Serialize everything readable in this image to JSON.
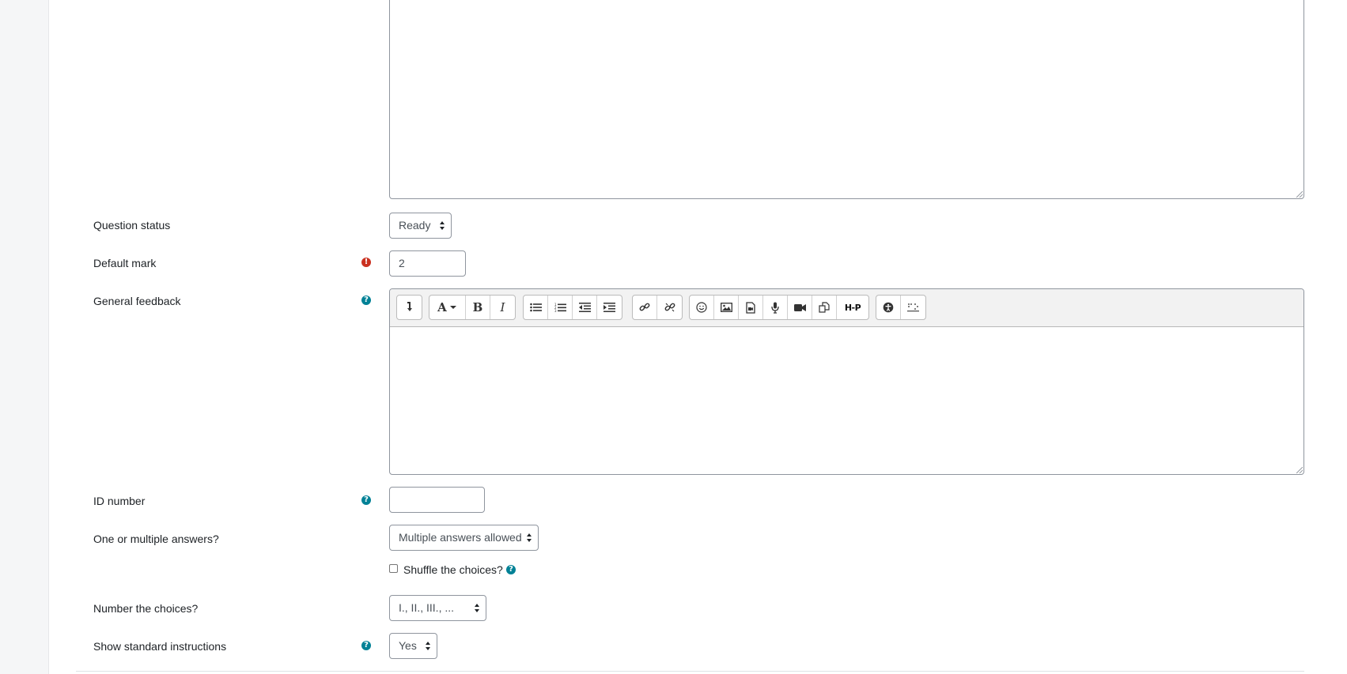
{
  "form": {
    "question_status": {
      "label": "Question status",
      "value": "Ready"
    },
    "default_mark": {
      "label": "Default mark",
      "value": "2"
    },
    "general_feedback": {
      "label": "General feedback"
    },
    "id_number": {
      "label": "ID number",
      "value": ""
    },
    "answers": {
      "label": "One or multiple answers?",
      "value": "Multiple answers allowed"
    },
    "shuffle": {
      "label": "Shuffle the choices?",
      "checked": false
    },
    "numbering": {
      "label": "Number the choices?",
      "value": "I., II., III., ..."
    },
    "instructions": {
      "label": "Show standard instructions",
      "value": "Yes"
    }
  },
  "editor_toolbar": {
    "buttons": [
      "collapse-icon",
      "font-style-icon",
      "bold-icon",
      "italic-icon",
      "unordered-list-icon",
      "ordered-list-icon",
      "outdent-icon",
      "indent-icon",
      "link-icon",
      "unlink-icon",
      "emoji-icon",
      "image-icon",
      "media-icon",
      "record-audio-icon",
      "record-video-icon",
      "manage-files-icon",
      "h5p-icon",
      "accessibility-checker-icon",
      "screenreader-helper-icon"
    ],
    "bold_glyph": "B",
    "italic_glyph": "I",
    "h5p_glyph": "H-P"
  },
  "colors": {
    "help": "#008196",
    "required": "#ca3120"
  }
}
